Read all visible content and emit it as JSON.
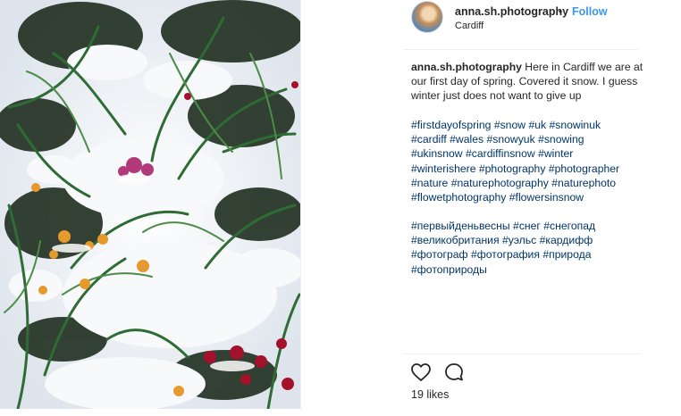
{
  "post": {
    "username": "anna.sh.photography",
    "separator": "•",
    "follow_label": "Follow",
    "location": "Cardiff",
    "caption_user": "anna.sh.photography",
    "caption_text": " Here in Cardiff we are at our first day of spring. Covered it snow. I guess winter just does not want to give up",
    "hashtag_lines": [
      [
        "#firstdayofspring",
        "#snow",
        "#uk",
        "#snowinuk"
      ],
      [
        "#cardiff",
        "#wales",
        "#snowyuk",
        "#snowing"
      ],
      [
        "#ukinsnow",
        "#cardiffinsnow",
        "#winter"
      ],
      [
        "#winterishere",
        "#photography",
        "#photographer"
      ],
      [
        "#nature",
        "#naturephotography",
        "#naturephoto"
      ],
      [
        "#flowetphotography",
        "#flowersinsnow"
      ]
    ],
    "hashtag_lines_ru": [
      [
        "#первыйденьвесны",
        "#снег",
        "#снегопад"
      ],
      [
        "#великобритания",
        "#уэльс",
        "#кардифф"
      ],
      [
        "#фотограф",
        "#фотография",
        "#природа"
      ],
      [
        "#фотоприроды"
      ]
    ],
    "likes": "19 likes"
  },
  "icons": {
    "like": "heart-icon",
    "comment": "comment-icon"
  },
  "colors": {
    "follow": "#3897f0",
    "hashtag": "#003569",
    "text": "#262626"
  }
}
